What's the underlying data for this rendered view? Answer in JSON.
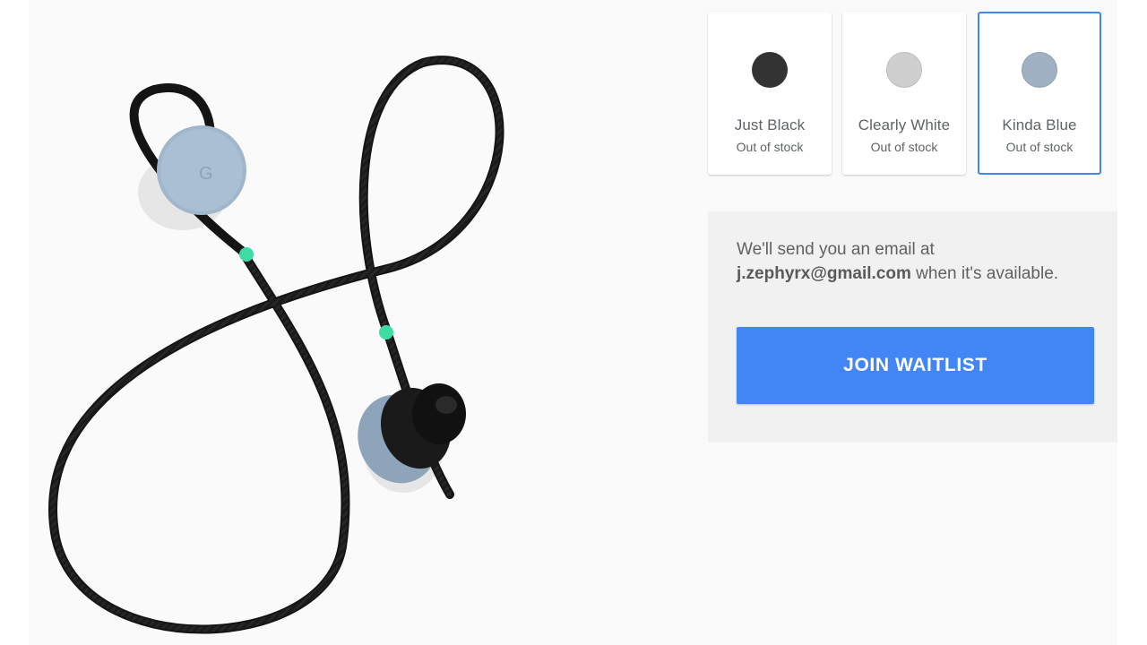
{
  "colors": {
    "accent": "#4285f4",
    "panel_bg": "#f1f1f1",
    "page_bg": "#fafafa"
  },
  "product": {
    "image_icon": "earbuds-product-image"
  },
  "swatches": [
    {
      "name": "Just Black",
      "stock": "Out of stock",
      "color": "#333333",
      "selected": false
    },
    {
      "name": "Clearly White",
      "stock": "Out of stock",
      "color": "#cfcfcf",
      "selected": false
    },
    {
      "name": "Kinda Blue",
      "stock": "Out of stock",
      "color": "#9fb1c2",
      "selected": true
    }
  ],
  "waitlist": {
    "message_line1": "We'll send you an email at",
    "email": "j.zephyrx@gmail.com",
    "message_suffix": " when it's available.",
    "button_label": "JOIN WAITLIST"
  }
}
